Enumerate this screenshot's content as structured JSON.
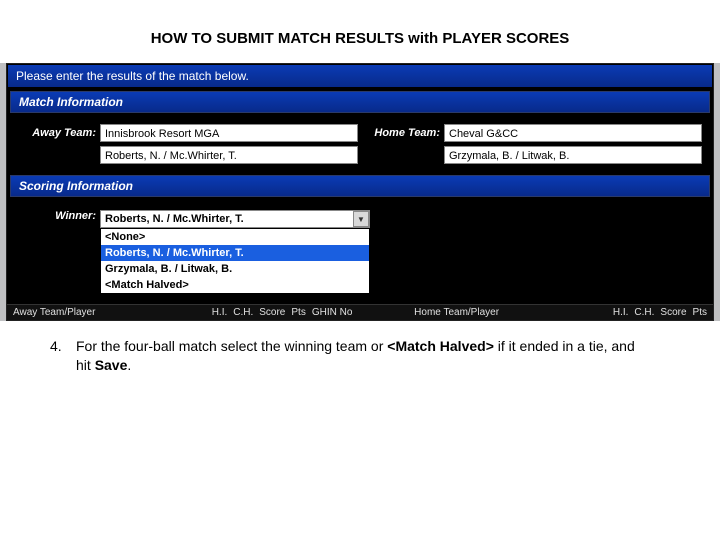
{
  "doc_title": "HOW TO SUBMIT MATCH RESULTS with PLAYER SCORES",
  "banner": "Please enter the results of the match below.",
  "sections": {
    "match_info": "Match Information",
    "scoring_info": "Scoring Information"
  },
  "labels": {
    "away_team": "Away Team:",
    "home_team": "Home Team:",
    "winner": "Winner:"
  },
  "away": {
    "team": "Innisbrook Resort MGA",
    "players": "Roberts, N. / Mc.Whirter, T."
  },
  "home": {
    "team": "Cheval G&CC",
    "players": "Grzymala, B. / Litwak, B."
  },
  "winner": {
    "selected": "Roberts, N. / Mc.Whirter, T.",
    "options": [
      "<None>",
      "Roberts, N. / Mc.Whirter, T.",
      "Grzymala, B. / Litwak, B.",
      "<Match Halved>"
    ]
  },
  "footer_cols": {
    "away_tp": "Away Team/Player",
    "hi": "H.I.",
    "ch": "C.H.",
    "score": "Score",
    "pts": "Pts",
    "ghin": "GHIN No",
    "home_tp": "Home Team/Player",
    "hi2": "H.I.",
    "ch2": "C.H.",
    "score2": "Score",
    "pts2": "Pts"
  },
  "instruction": {
    "num": "4.",
    "pre": "For the four-ball match select the winning team or ",
    "bold1": "<Match Halved>",
    "mid": " if it ended in a tie, and hit ",
    "bold2": "Save",
    "post": "."
  }
}
